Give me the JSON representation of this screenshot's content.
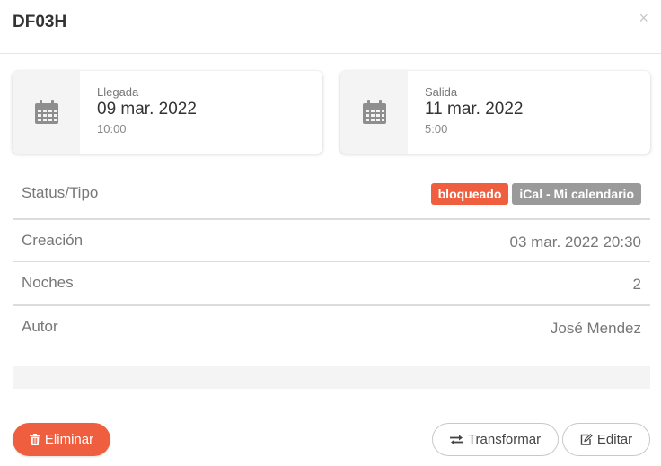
{
  "header": {
    "title": "DF03H",
    "close_glyph": "×",
    "close_icon": "close-icon"
  },
  "arrival": {
    "label": "Llegada",
    "date": "09 mar. 2022",
    "time": "10:00",
    "icon": "calendar-icon"
  },
  "departure": {
    "label": "Salida",
    "date": "11 mar. 2022",
    "time": "5:00",
    "icon": "calendar-icon"
  },
  "details": {
    "status": {
      "label": "Status/Tipo",
      "badges": [
        "bloqueado",
        "iCal - Mi calendario"
      ]
    },
    "creation": {
      "label": "Creación",
      "value": "03 mar. 2022 20:30"
    },
    "nights": {
      "label": "Noches",
      "value": "2"
    },
    "author": {
      "label": "Autor",
      "value": "José Mendez"
    }
  },
  "actions": {
    "delete_label": "Eliminar",
    "delete_icon": "trash-icon",
    "transform_label": "Transformar",
    "transform_icon": "exchange-icon",
    "edit_label": "Editar",
    "edit_icon": "edit-icon"
  },
  "colors": {
    "accent": "#ee5e3f",
    "badge_gray": "#9a9a9a",
    "card_icon_bg": "#f4f4f4"
  }
}
